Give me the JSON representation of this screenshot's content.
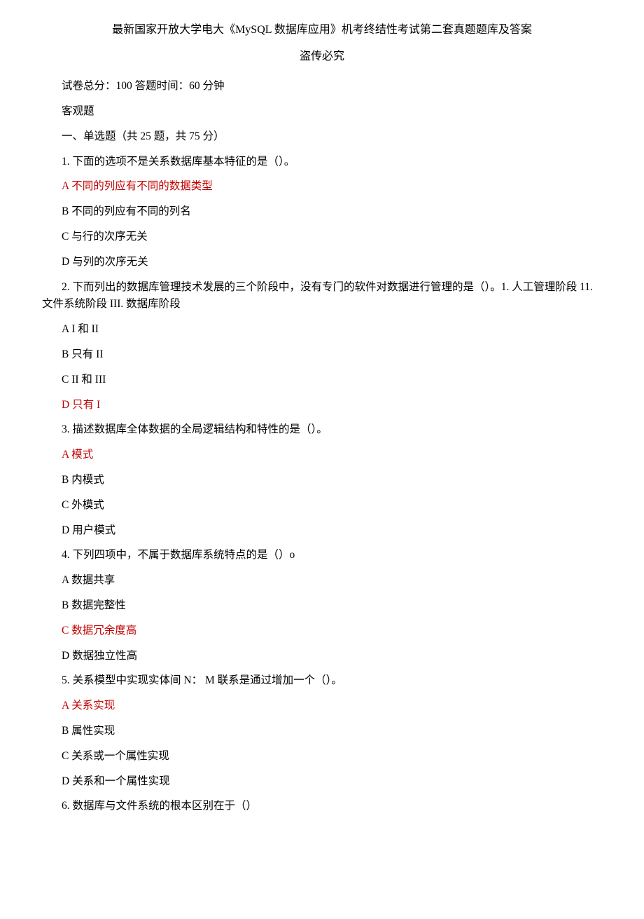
{
  "title": "最新国家开放大学电大《MySQL 数据库应用》机考终结性考试第二套真题题库及答案",
  "subtitle": "盗传必究",
  "info": "试卷总分：100 答题时间：60 分钟",
  "section_objective": "客观题",
  "section_single": "一、单选题（共 25 题，共 75 分）",
  "q1": {
    "stem": "1. 下面的选项不是关系数据库基本特征的是（）。",
    "a": "A 不同的列应有不同的数据类型",
    "b": "B 不同的列应有不同的列名",
    "c": "C 与行的次序无关",
    "d": "D 与列的次序无关"
  },
  "q2": {
    "stem": "2. 下而列出的数据库管理技术发展的三个阶段中，没有专门的软件对数据进行管理的是（）。1. 人工管理阶段 11. 文件系统阶段 III. 数据库阶段",
    "a": "A I 和 II",
    "b": "B 只有 II",
    "c": "C II 和 III",
    "d": "D 只有 I"
  },
  "q3": {
    "stem": "3. 描述数据库全体数据的全局逻辑结构和特性的是（）。",
    "a": "A 模式",
    "b": "B 内模式",
    "c": "C 外模式",
    "d": "D 用户模式"
  },
  "q4": {
    "stem": "4. 下列四项中，不属于数据库系统特点的是（）o",
    "a": "A 数据共享",
    "b": "B 数据完整性",
    "c": "C 数据冗余度高",
    "d": "D 数据独立性高"
  },
  "q5": {
    "stem": "5. 关系模型中实现实体间 N：  M 联系是通过增加一个（）。",
    "a": "A 关系实现",
    "b": "B 属性实现",
    "c": "C 关系或一个属性实现",
    "d": "D 关系和一个属性实现"
  },
  "q6": {
    "stem": "6. 数据库与文件系统的根本区别在于（）"
  }
}
